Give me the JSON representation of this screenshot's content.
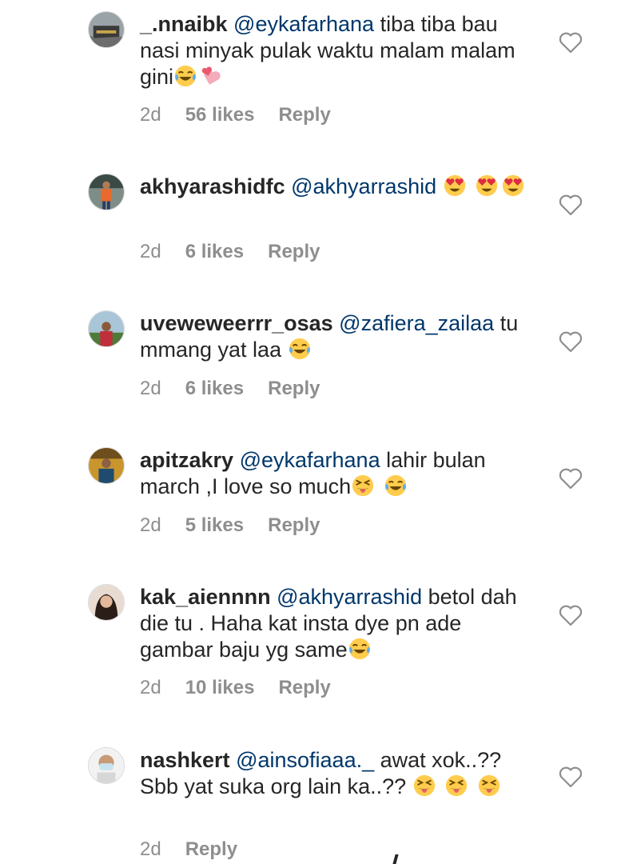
{
  "comments": [
    {
      "username": "_.nnaibk",
      "mention": "@eykafarhana",
      "text": " tiba tiba bau nasi minyak pulak waktu malam malam gini",
      "time": "2d",
      "likes": "56 likes",
      "reply": "Reply",
      "emojis": [
        "face-with-tears-of-joy",
        "revolving-hearts"
      ]
    },
    {
      "username": "akhyarashidfc",
      "mention": "@akhyarrashid",
      "text": " ",
      "time": "2d",
      "likes": "6 likes",
      "reply": "Reply",
      "emojis": [
        "heart-eyes",
        "heart-eyes",
        "heart-eyes"
      ]
    },
    {
      "username": "uveweweerrr_osas",
      "mention": "@zafiera_zailaa",
      "text": " tu mmang yat laa ",
      "time": "2d",
      "likes": "6 likes",
      "reply": "Reply",
      "emojis": [
        "face-with-tears-of-joy"
      ]
    },
    {
      "username": "apitzakry",
      "mention": "@eykafarhana",
      "text": " lahir bulan march ,I love so much",
      "time": "2d",
      "likes": "5 likes",
      "reply": "Reply",
      "emojis": [
        "squinting-tongue",
        "face-with-tears-of-joy"
      ]
    },
    {
      "username": "kak_aiennnn",
      "mention": "@akhyarrashid",
      "text": " betol dah die tu . Haha kat insta dye pn ade gambar baju yg same",
      "time": "2d",
      "likes": "10 likes",
      "reply": "Reply",
      "emojis": [
        "face-with-tears-of-joy"
      ]
    },
    {
      "username": "nashkert",
      "mention": "@ainsofiaaa._",
      "text": " awat xok..?? Sbb yat suka org lain ka..?? ",
      "time": "2d",
      "likes": "",
      "reply": "Reply",
      "emojis": [
        "squinting-tongue",
        "squinting-tongue",
        "squinting-tongue"
      ]
    }
  ],
  "icons": {
    "like": "heart-outline-icon",
    "avatar": "profile-avatar"
  },
  "colors": {
    "mention": "#00376b",
    "meta": "#8e8e8e",
    "text": "#262626"
  }
}
